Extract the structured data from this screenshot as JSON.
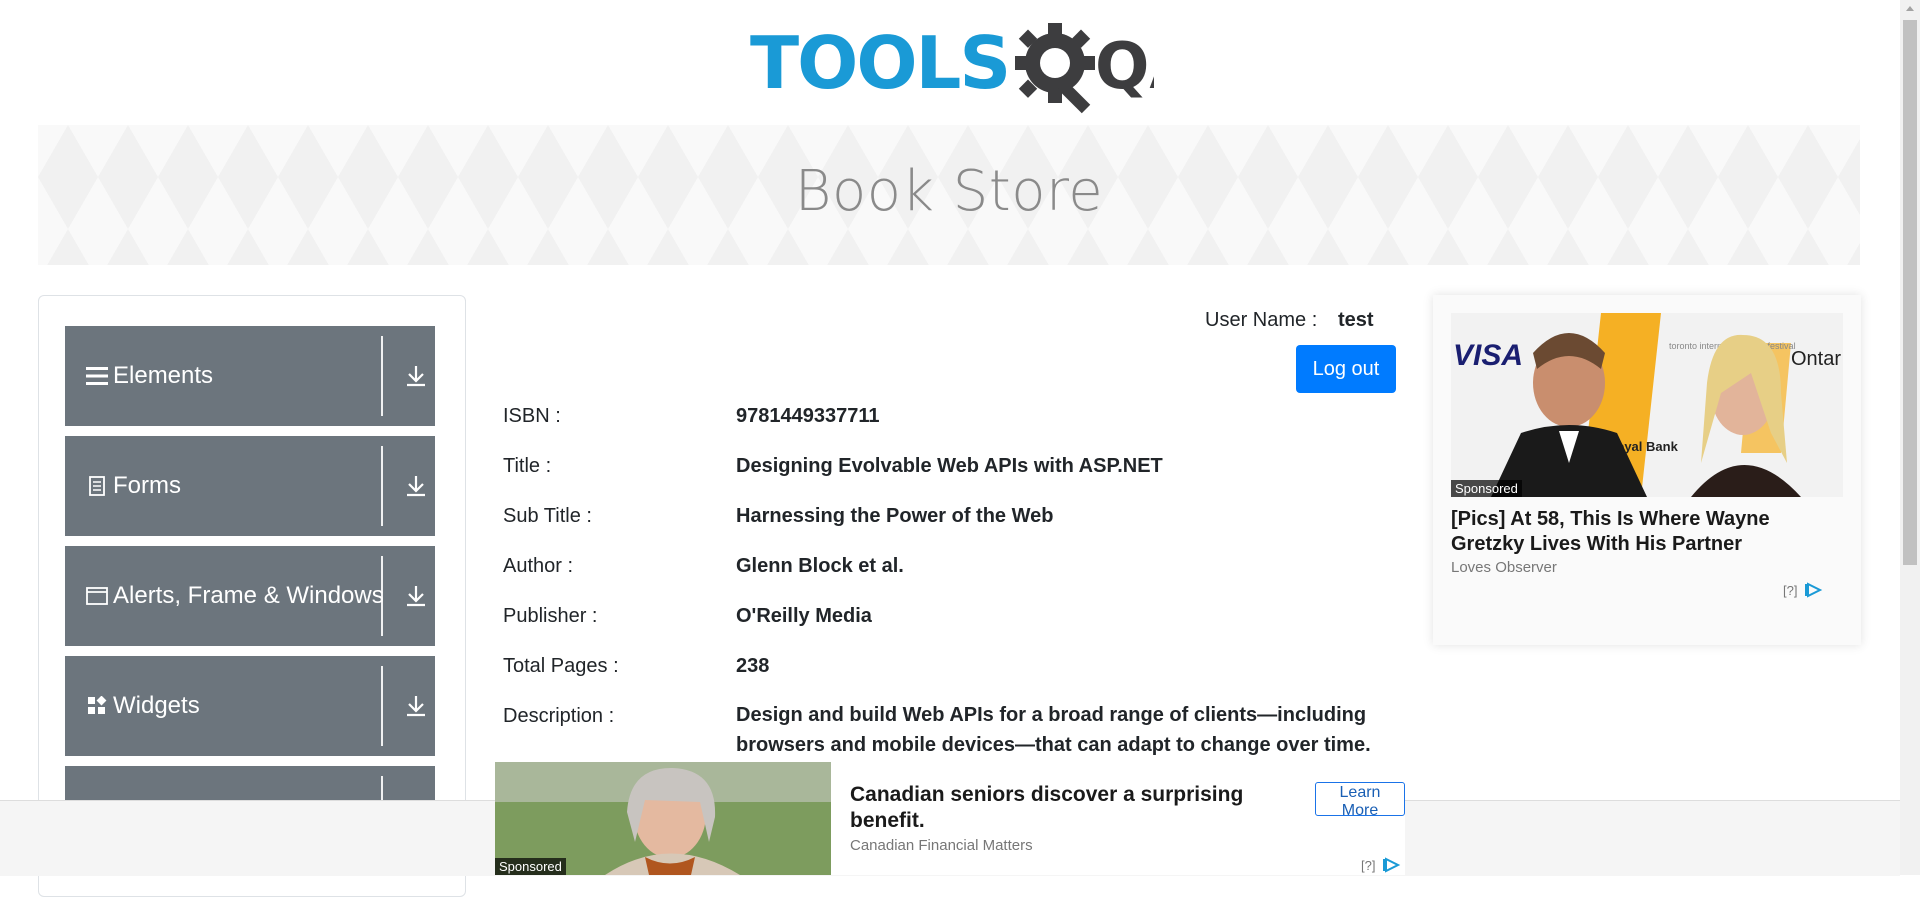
{
  "logo": {
    "text_tools": "TOOLS",
    "text_qa": "QA"
  },
  "banner": {
    "title": "Book Store"
  },
  "sidebar": {
    "items": [
      {
        "label": "Elements",
        "icon": "hamburger-icon"
      },
      {
        "label": "Forms",
        "icon": "document-icon"
      },
      {
        "label": "Alerts, Frame & Windows",
        "icon": "window-icon"
      },
      {
        "label": "Widgets",
        "icon": "widgets-grid-icon"
      },
      {
        "label": "",
        "icon": ""
      }
    ]
  },
  "user": {
    "label": "User Name :",
    "value": "test",
    "logout_label": "Log out"
  },
  "book": {
    "rows": [
      {
        "label": "ISBN :",
        "value": "9781449337711"
      },
      {
        "label": "Title :",
        "value": "Designing Evolvable Web APIs with ASP.NET"
      },
      {
        "label": "Sub Title :",
        "value": "Harnessing the Power of the Web"
      },
      {
        "label": "Author :",
        "value": "Glenn Block et al."
      },
      {
        "label": "Publisher :",
        "value": "O'Reilly Media"
      },
      {
        "label": "Total Pages :",
        "value": "238"
      },
      {
        "label": "Description :",
        "value": "Design and build Web APIs for a broad range of clients—including browsers and mobile devices—that can adapt to change over time. This"
      }
    ]
  },
  "side_ad": {
    "sponsored": "Sponsored",
    "headline": "[Pics] At 58, This Is Where Wayne Gretzky Lives With His Partner",
    "source": "Loves Observer",
    "info": "[?]",
    "logo_texts": [
      "VISA",
      "Ontar",
      "Royal Bank",
      "toronto international film festival"
    ]
  },
  "bottom_ad": {
    "sponsored": "Sponsored",
    "headline": "Canadian seniors discover a surprising benefit.",
    "source": "Canadian Financial Matters",
    "cta": "Learn More",
    "info": "[?]"
  },
  "colors": {
    "sidebar_item_bg": "#6c757d",
    "logout_bg": "#007bff",
    "logo_blue": "#1a9ad6",
    "logo_dark": "#3d3d3f"
  }
}
